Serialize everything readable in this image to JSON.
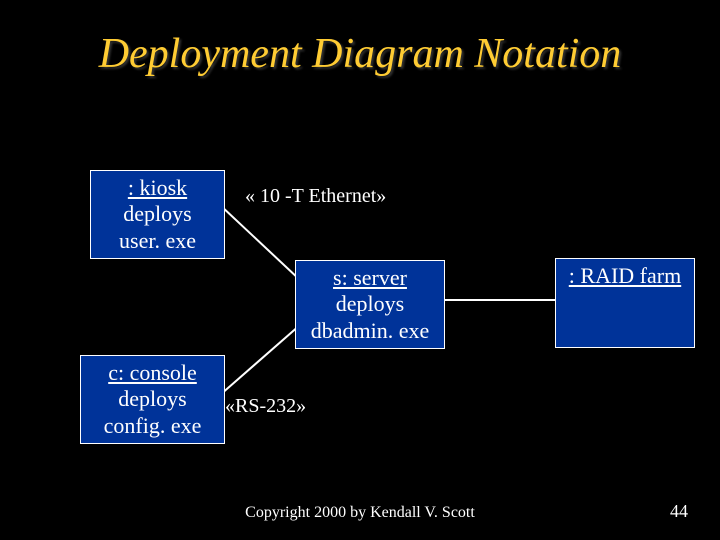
{
  "title": "Deployment Diagram Notation",
  "nodes": {
    "kiosk": {
      "name": ": kiosk",
      "body": "deploys\nuser. exe"
    },
    "server": {
      "name": "s: server",
      "body": "deploys\ndbadmin. exe"
    },
    "console": {
      "name": "c: console",
      "body": "deploys\nconfig. exe"
    },
    "raid": {
      "name": ": RAID farm",
      "body": ""
    }
  },
  "labels": {
    "ethernet": "« 10 -T Ethernet»",
    "rs232": "«RS-232»"
  },
  "footer": "Copyright 2000 by Kendall V. Scott",
  "page": "44"
}
